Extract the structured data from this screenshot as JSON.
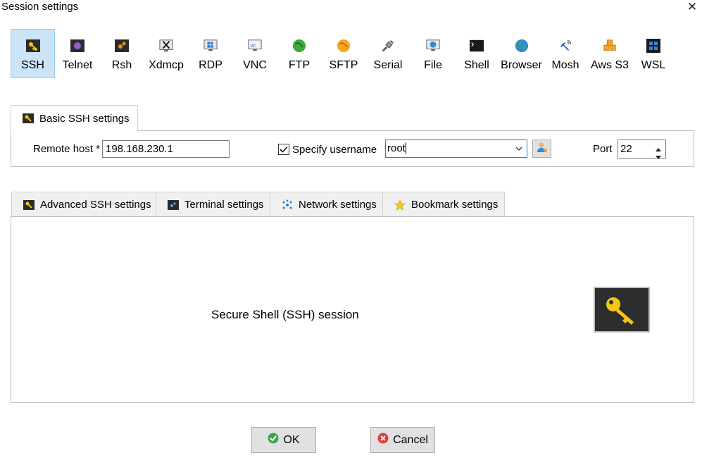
{
  "window": {
    "title": "Session settings"
  },
  "session_types": [
    {
      "label": "SSH",
      "icon": "ssh-key-icon"
    },
    {
      "label": "Telnet",
      "icon": "telnet-icon"
    },
    {
      "label": "Rsh",
      "icon": "rsh-icon"
    },
    {
      "label": "Xdmcp",
      "icon": "xdmcp-icon"
    },
    {
      "label": "RDP",
      "icon": "rdp-icon"
    },
    {
      "label": "VNC",
      "icon": "vnc-icon"
    },
    {
      "label": "FTP",
      "icon": "ftp-icon"
    },
    {
      "label": "SFTP",
      "icon": "sftp-icon"
    },
    {
      "label": "Serial",
      "icon": "serial-plug-icon"
    },
    {
      "label": "File",
      "icon": "file-globe-icon"
    },
    {
      "label": "Shell",
      "icon": "shell-terminal-icon"
    },
    {
      "label": "Browser",
      "icon": "browser-globe-icon"
    },
    {
      "label": "Mosh",
      "icon": "mosh-satellite-icon"
    },
    {
      "label": "Aws S3",
      "icon": "aws-s3-cubes-icon"
    },
    {
      "label": "WSL",
      "icon": "wsl-windows-icon"
    }
  ],
  "basic_tab": {
    "label": "Basic SSH settings"
  },
  "remote_host": {
    "label": "Remote host *",
    "value": "198.168.230.1"
  },
  "specify_username": {
    "label": "Specify username",
    "checked": true,
    "value": "root"
  },
  "port": {
    "label": "Port",
    "value": "22"
  },
  "advanced_tabs": [
    {
      "label": "Advanced SSH settings",
      "icon": "ssh-key-icon"
    },
    {
      "label": "Terminal settings",
      "icon": "terminal-icon"
    },
    {
      "label": "Network settings",
      "icon": "network-icon"
    },
    {
      "label": "Bookmark settings",
      "icon": "star-icon"
    }
  ],
  "session_description": "Secure Shell (SSH) session",
  "buttons": {
    "ok": "OK",
    "cancel": "Cancel"
  },
  "colors": {
    "selected_bg": "#cce4f7",
    "key_yellow": "#f5c518",
    "ok_green": "#3aa84a",
    "cancel_red": "#e03a3a"
  }
}
